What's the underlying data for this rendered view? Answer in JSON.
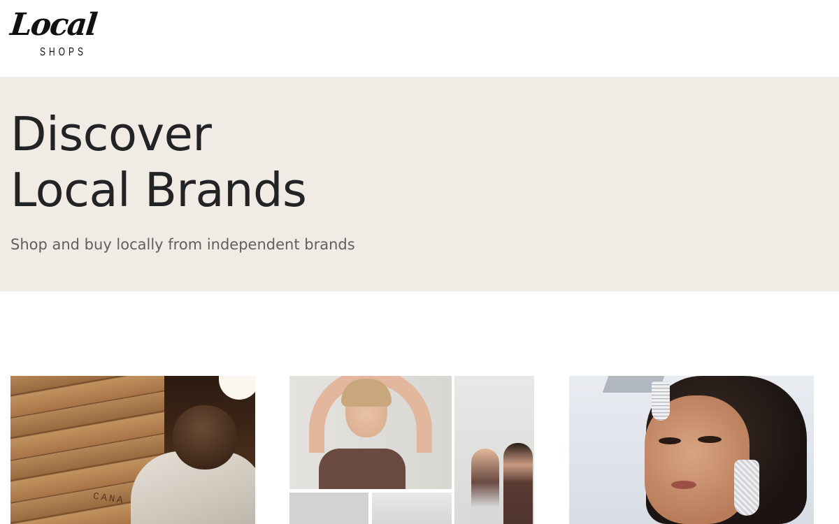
{
  "header": {
    "logo": {
      "word": "Local",
      "sub": "SHOPS"
    }
  },
  "hero": {
    "title_line1": "Discover",
    "title_line2": "Local Brands",
    "subtitle": "Shop and buy locally from independent brands",
    "background_color": "#f1ebe6"
  },
  "cards": [
    {
      "image": "man-in-hoodie-wood-wall-photo",
      "wall_text": "CANA"
    },
    {
      "image": "women-activewear-collage-photo"
    },
    {
      "image": "bridal-jewelry-portrait-photo"
    }
  ]
}
